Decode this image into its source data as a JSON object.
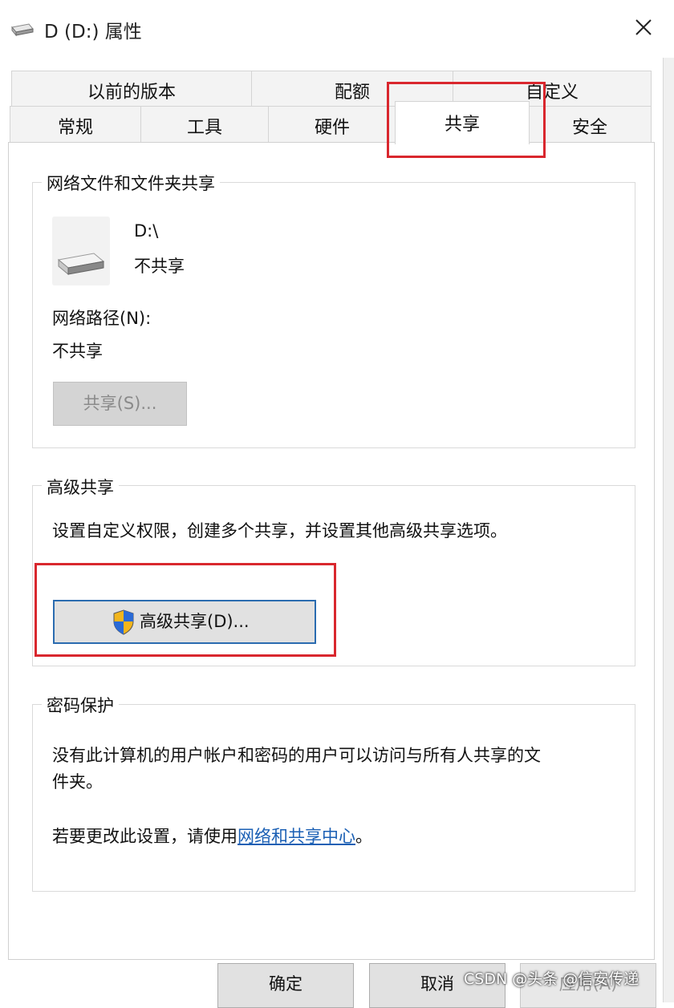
{
  "window": {
    "title": "D (D:) 属性",
    "close_icon": "close-icon",
    "drive_icon": "drive-icon"
  },
  "tabs": {
    "row1": [
      "以前的版本",
      "配额",
      "自定义"
    ],
    "row2": [
      "常规",
      "工具",
      "硬件",
      "共享",
      "安全"
    ],
    "active": "共享"
  },
  "network_sharing": {
    "legend": "网络文件和文件夹共享",
    "drive_name": "D:\\",
    "share_status": "不共享",
    "path_label": "网络路径(N):",
    "path_value": "不共享",
    "share_button": "共享(S)..."
  },
  "advanced_sharing": {
    "legend": "高级共享",
    "description": "设置自定义权限，创建多个共享，并设置其他高级共享选项。",
    "button": "高级共享(D)...",
    "button_icon": "uac-shield-icon"
  },
  "password_protection": {
    "legend": "密码保护",
    "line1": "没有此计算机的用户帐户和密码的用户可以访问与所有人共享的文",
    "line2": "件夹。",
    "change_prefix": "若要更改此设置，请使用",
    "change_link": "网络和共享中心",
    "change_suffix": "。"
  },
  "footer": {
    "ok": "确定",
    "cancel": "取消",
    "apply": "应用(A)"
  },
  "watermark": "CSDN @头条 @信安传递",
  "colors": {
    "highlight_red": "#d9272e",
    "focus_blue": "#2b6cb0",
    "link_blue": "#1a5fb4"
  }
}
